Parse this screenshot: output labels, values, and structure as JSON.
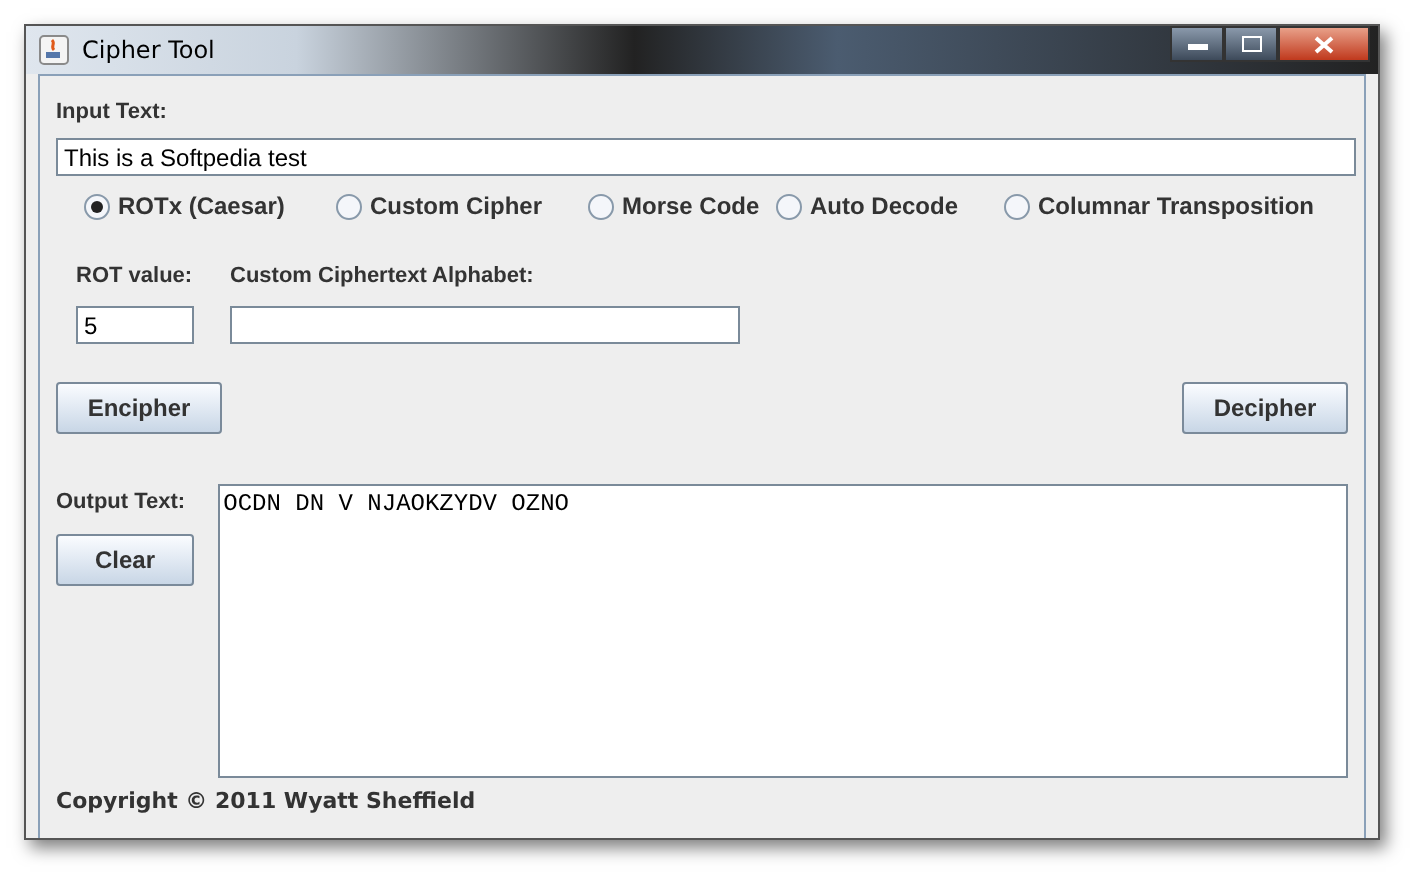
{
  "window": {
    "title": "Cipher Tool"
  },
  "input_text": {
    "label": "Input Text:",
    "value": "This is a Softpedia test"
  },
  "modes": [
    {
      "label": "ROTx (Caesar)",
      "selected": true
    },
    {
      "label": "Custom Cipher",
      "selected": false
    },
    {
      "label": "Morse Code",
      "selected": false
    },
    {
      "label": "Auto Decode",
      "selected": false
    },
    {
      "label": "Columnar Transposition",
      "selected": false
    }
  ],
  "rot_value": {
    "label": "ROT value:",
    "value": "5"
  },
  "custom_alphabet": {
    "label": "Custom Ciphertext Alphabet:"
  },
  "buttons": {
    "encipher": "Encipher",
    "decipher": "Decipher",
    "clear": "Clear"
  },
  "output_text": {
    "label": "Output Text:",
    "value": "OCDN DN V NJAOKZYDV OZNO"
  },
  "footer": "Copyright © 2011 Wyatt Sheffield"
}
